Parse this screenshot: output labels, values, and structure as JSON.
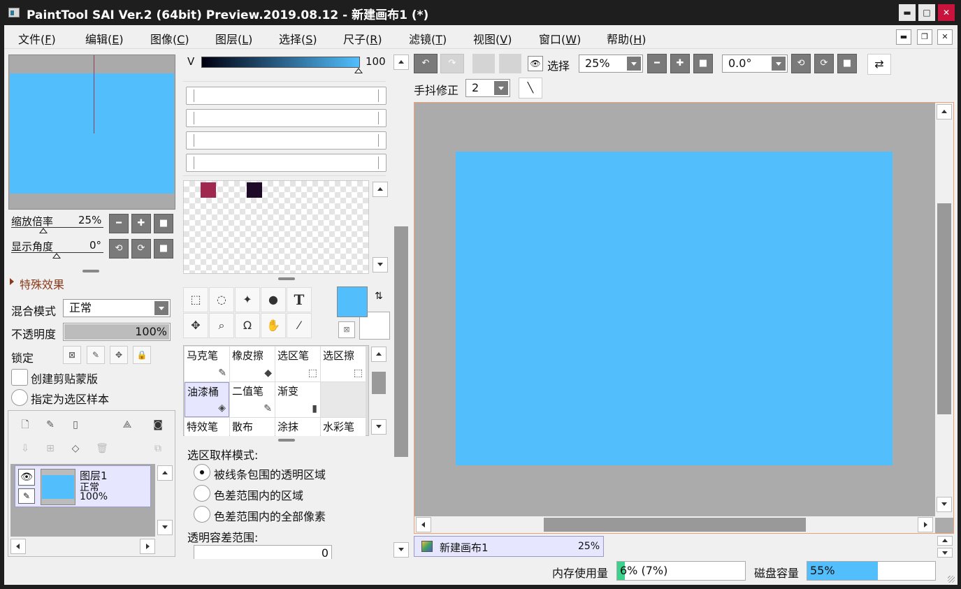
{
  "window": {
    "title": "PaintTool SAI Ver.2 (64bit) Preview.2019.08.12 - 新建画布1 (*)",
    "controls": {
      "minimize": "▬",
      "maximize": "□",
      "close": "✕"
    }
  },
  "menu": [
    {
      "label": "文件(",
      "key": "F",
      "end": ")"
    },
    {
      "label": "编辑(",
      "key": "E",
      "end": ")"
    },
    {
      "label": "图像(",
      "key": "C",
      "end": ")"
    },
    {
      "label": "图层(",
      "key": "L",
      "end": ")"
    },
    {
      "label": "选择(",
      "key": "S",
      "end": ")"
    },
    {
      "label": "尺子(",
      "key": "R",
      "end": ")"
    },
    {
      "label": "滤镜(",
      "key": "T",
      "end": ")"
    },
    {
      "label": "视图(",
      "key": "V",
      "end": ")"
    },
    {
      "label": "窗口(",
      "key": "W",
      "end": ")"
    },
    {
      "label": "帮助(",
      "key": "H",
      "end": ")"
    }
  ],
  "mdi": {
    "minimize": "▬",
    "restore": "❐",
    "close": "✕"
  },
  "navigator": {
    "zoom_label": "缩放倍率",
    "zoom_value": "25%",
    "angle_label": "显示角度",
    "angle_value": "0°",
    "zoom_minus": "━",
    "zoom_plus": "✚",
    "zoom_reset": "■",
    "rot_ccw": "⟲",
    "rot_cw": "⟳",
    "rot_reset": "■"
  },
  "layer_props": {
    "effects_label": "特殊效果",
    "blend_label": "混合模式",
    "blend_value": "正常",
    "opacity_label": "不透明度",
    "opacity_value": "100%",
    "opacity_level": 1.0,
    "lock_label": "锁定",
    "clipping_label": "创建剪贴蒙版",
    "sample_label": "指定为选区样本"
  },
  "layers": [
    {
      "name": "图层1",
      "mode": "正常",
      "opacity": "100%"
    }
  ],
  "color": {
    "v_label": "V",
    "v_value": "100",
    "primary": "#52befc",
    "secondary": "#ffffff",
    "swatches": [
      "#a0284e",
      "#1e0a28"
    ]
  },
  "tools": [
    "选区",
    "套索",
    "魔棒",
    "形状",
    "T",
    "移动",
    "缩放",
    "旋转",
    "抓手",
    "吸管"
  ],
  "brushes": [
    {
      "name": "马克笔",
      "icon": "✎"
    },
    {
      "name": "橡皮擦",
      "icon": "◆"
    },
    {
      "name": "选区笔",
      "icon": "⬚"
    },
    {
      "name": "选区擦",
      "icon": "⬚"
    },
    {
      "name": "油漆桶",
      "icon": "◈"
    },
    {
      "name": "二值笔",
      "icon": "✎"
    },
    {
      "name": "渐变",
      "icon": "▮"
    },
    {
      "name": "",
      "icon": ""
    },
    {
      "name": "特效笔",
      "icon": ""
    },
    {
      "name": "散布",
      "icon": ""
    },
    {
      "name": "涂抹",
      "icon": ""
    },
    {
      "name": "水彩笔",
      "icon": ""
    }
  ],
  "tool_options": {
    "mode_label": "选区取样模式:",
    "options": [
      "被线条包围的透明区域",
      "色差范围内的区域",
      "色差范围内的全部像素"
    ],
    "selected": 0,
    "tolerance_label": "透明容差范围:",
    "tolerance_value": "0"
  },
  "toolbar": {
    "undo": "↶",
    "redo": "↷",
    "select_label": "选择",
    "zoom_value": "25%",
    "angle_value": "0.0°",
    "stabilizer_label": "手抖修正",
    "stabilizer_value": "2",
    "line_icon": "╲",
    "flip_icon": "⇄",
    "minus": "━",
    "plus": "✚",
    "reset": "■",
    "rot_ccw": "⟲",
    "rot_cw": "⟳"
  },
  "canvas": {
    "background": "#ababab",
    "image_color": "#52befc"
  },
  "doc_tab": {
    "name": "新建画布1",
    "zoom": "25%"
  },
  "status": {
    "memory_label": "内存使用量",
    "memory_value": "6% (7%)",
    "memory_level": 0.06,
    "memory_color": "#3cd28c",
    "disk_label": "磁盘容量",
    "disk_value": "55%",
    "disk_level": 0.55,
    "disk_color": "#52befc"
  }
}
